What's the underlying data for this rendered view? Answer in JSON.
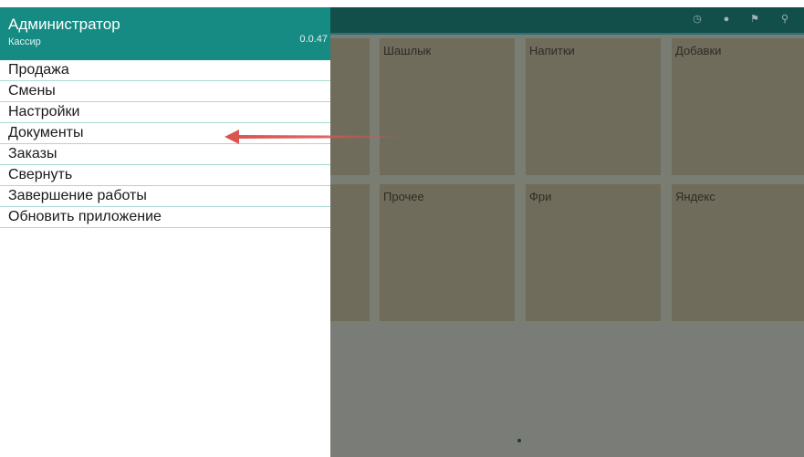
{
  "app": {
    "tiles": [
      {
        "label": "Шашлык"
      },
      {
        "label": "Напитки"
      },
      {
        "label": "Добавки"
      },
      {
        "label": "Прочее"
      },
      {
        "label": "Фри"
      },
      {
        "label": "Яндекс"
      }
    ],
    "topbar_icons": [
      "clock-icon",
      "dot-icon",
      "flag-icon",
      "search-icon"
    ]
  },
  "drawer": {
    "user_name": "Администратор",
    "role": "Кассир",
    "version": "0.0.47",
    "menu": [
      {
        "label": "Продажа"
      },
      {
        "label": "Смены"
      },
      {
        "label": "Настройки"
      },
      {
        "label": "Документы"
      },
      {
        "label": "Заказы"
      },
      {
        "label": "Свернуть"
      },
      {
        "label": "Завершение работы"
      },
      {
        "label": "Обновить приложение"
      }
    ]
  },
  "colors": {
    "drawer_header": "#168b83",
    "topbar": "#124f4b",
    "arrow": "#d9534f"
  }
}
